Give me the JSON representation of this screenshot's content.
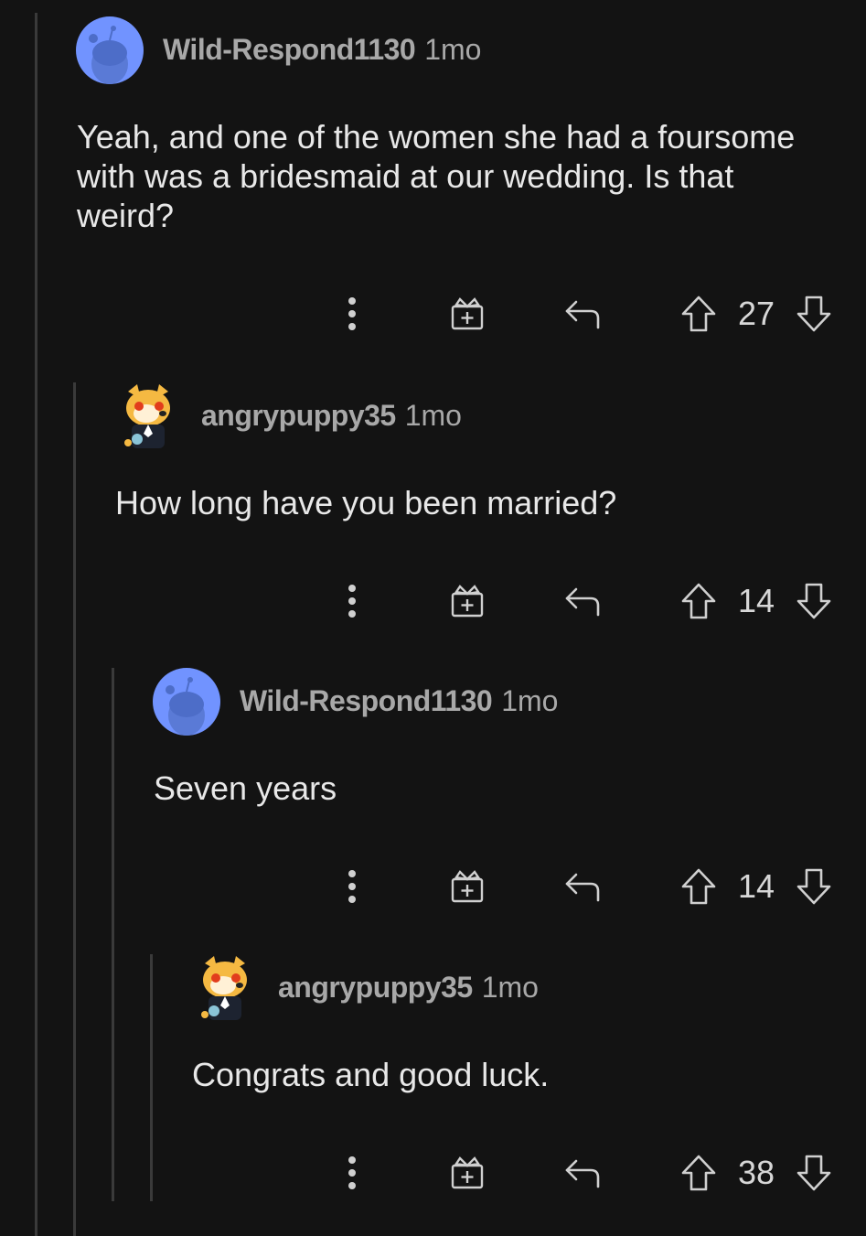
{
  "comments": [
    {
      "username": "Wild-Respond1130",
      "time": "1mo",
      "lines": [
        "Yeah, and one of the women she had a foursome",
        "with was a bridesmaid at our wedding. Is that",
        "weird?"
      ],
      "score": "27",
      "avatar": "snoo-avatar",
      "avatar_color": "#7193ff"
    },
    {
      "username": "angrypuppy35",
      "time": "1mo",
      "lines": [
        "How long have you been married?"
      ],
      "score": "14",
      "avatar": "shiba-avatar",
      "avatar_color": "#f5b942"
    },
    {
      "username": "Wild-Respond1130",
      "time": "1mo",
      "lines": [
        "Seven years"
      ],
      "score": "14",
      "avatar": "snoo-avatar",
      "avatar_color": "#7193ff"
    },
    {
      "username": "angrypuppy35",
      "time": "1mo",
      "lines": [
        "Congrats and good luck."
      ],
      "score": "38",
      "avatar": "shiba-avatar",
      "avatar_color": "#f5b942"
    }
  ],
  "icons": {
    "more": "more-options-icon",
    "award": "award-icon",
    "reply": "reply-icon",
    "upvote": "upvote-icon",
    "downvote": "downvote-icon"
  },
  "colors": {
    "background": "#131313",
    "thread_line": "#3a3a3a",
    "text": "#e8e8e8",
    "muted": "#a8a8a8"
  }
}
